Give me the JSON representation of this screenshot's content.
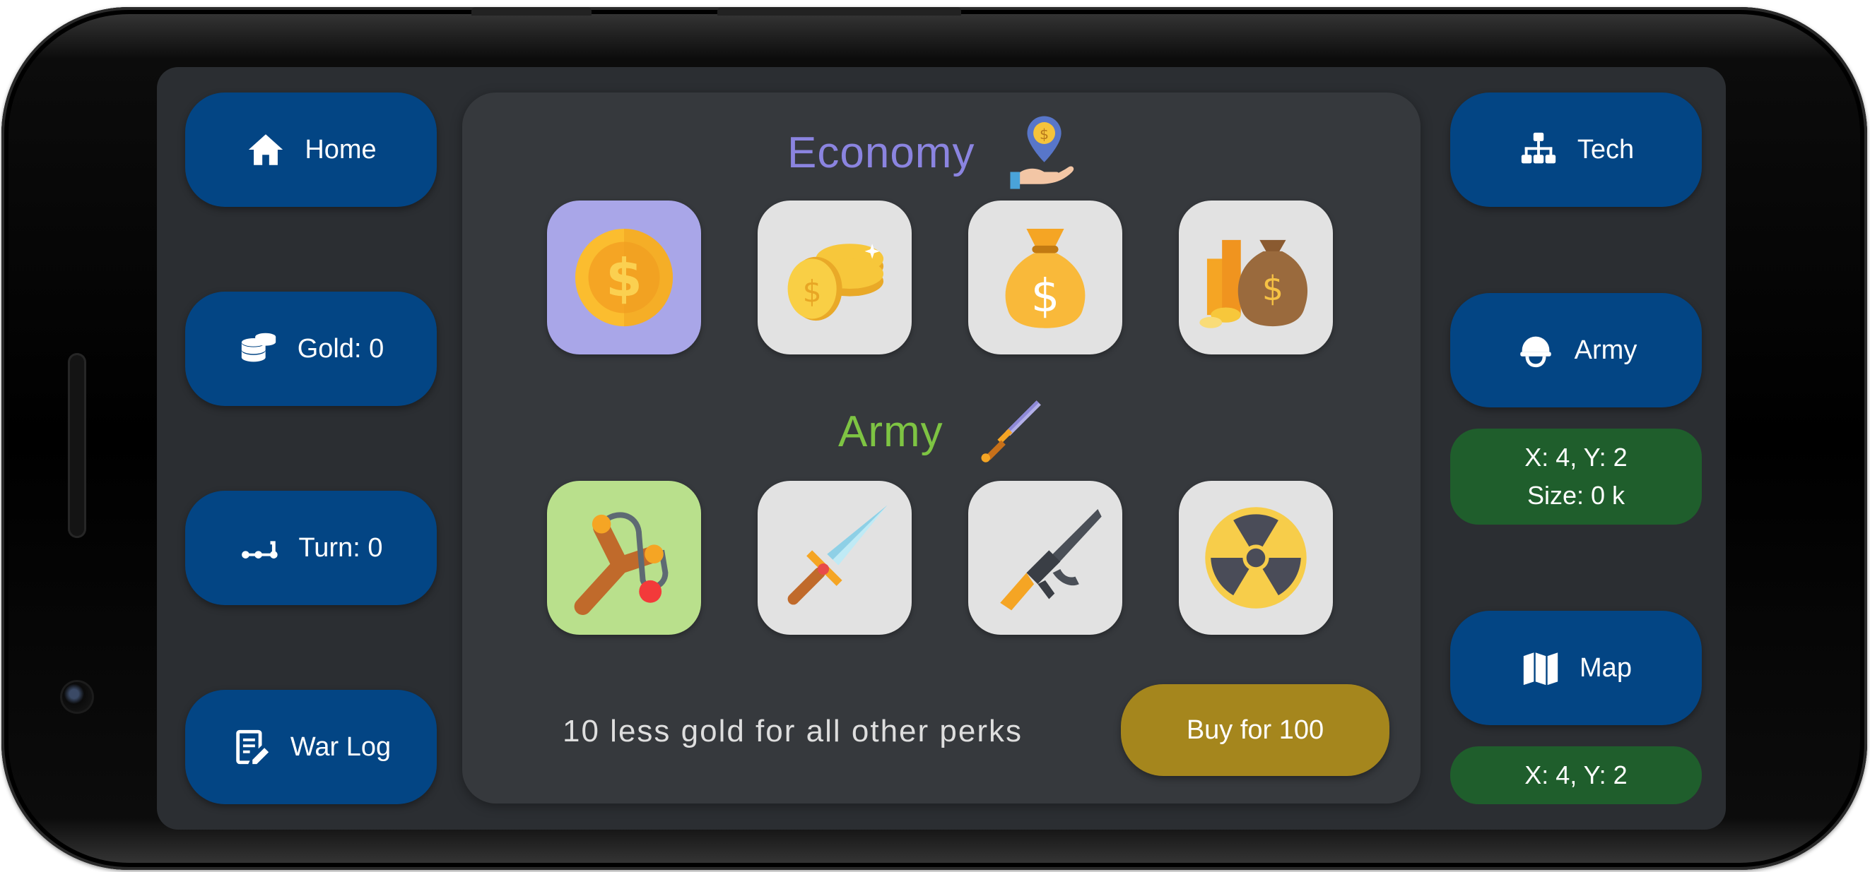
{
  "left_nav": {
    "home_label": "Home",
    "gold_label": "Gold: 0",
    "turn_label": "Turn: 0",
    "warlog_label": "War Log"
  },
  "right_nav": {
    "tech_label": "Tech",
    "army_label": "Army",
    "army_info_line1": "X: 4, Y: 2",
    "army_info_line2": "Size: 0 k",
    "map_label": "Map",
    "map_info": "X: 4, Y: 2"
  },
  "perks": {
    "economy": {
      "title": "Economy",
      "title_color": "#8b84e0",
      "items": [
        {
          "icon": "gold-coin-icon",
          "selected": true,
          "tile_color": "#a9a6e8"
        },
        {
          "icon": "coin-stack-icon",
          "selected": false
        },
        {
          "icon": "money-bag-icon",
          "selected": false
        },
        {
          "icon": "treasure-bag-icon",
          "selected": false
        }
      ]
    },
    "army": {
      "title": "Army",
      "title_color": "#7ec443",
      "items": [
        {
          "icon": "slingshot-icon",
          "selected": true,
          "tile_color": "#b9e08c"
        },
        {
          "icon": "sword-icon",
          "selected": false
        },
        {
          "icon": "rifle-icon",
          "selected": false
        },
        {
          "icon": "radiation-icon",
          "selected": false
        }
      ]
    },
    "description": "10 less gold for all other perks",
    "buy_label": "Buy for 100"
  },
  "colors": {
    "nav_button": "#034584",
    "info_box": "#1f5e2c",
    "buy_button": "#a5861d",
    "panel": "#36393d",
    "screen": "#2b2e32"
  }
}
